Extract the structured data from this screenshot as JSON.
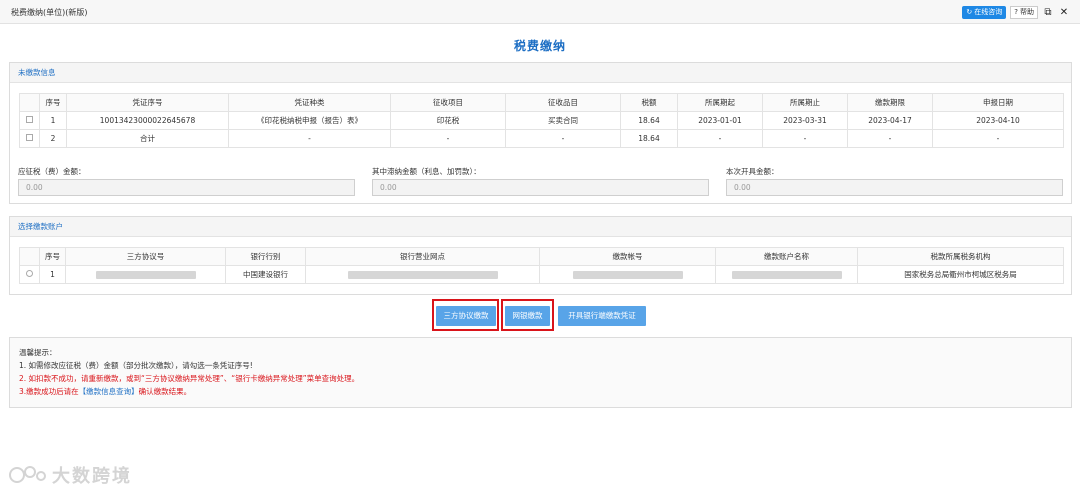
{
  "window": {
    "title": "税费缴纳(单位)(新版)",
    "online_consult": "在线咨询",
    "help": "帮助"
  },
  "page_title": "税费缴纳",
  "unpaid": {
    "section_title": "未缴款信息",
    "headers": [
      "序号",
      "凭证序号",
      "凭证种类",
      "征收项目",
      "征收品目",
      "税额",
      "所属期起",
      "所属期止",
      "缴款期限",
      "申报日期"
    ],
    "rows": [
      {
        "seq": "1",
        "voucher_no": "10013423000022645678",
        "voucher_type": "《印花税纳税申报（报告）表》",
        "item": "印花税",
        "sub_item": "买卖合同",
        "tax": "18.64",
        "period_start": "2023-01-01",
        "period_end": "2023-03-31",
        "deadline": "2023-04-17",
        "declare_date": "2023-04-10"
      },
      {
        "seq": "2",
        "voucher_no": "合计",
        "voucher_type": "-",
        "item": "-",
        "sub_item": "-",
        "tax": "18.64",
        "period_start": "-",
        "period_end": "-",
        "deadline": "-",
        "declare_date": "-"
      }
    ],
    "amounts": {
      "due_label": "应征税（费）金额：",
      "due_value": "0.00",
      "late_label": "其中滞纳金额（利息、加罚款）：",
      "late_value": "0.00",
      "invoice_label": "本次开具金额：",
      "invoice_value": "0.00"
    }
  },
  "account": {
    "section_title": "选择缴款账户",
    "headers": [
      "序号",
      "三方协议号",
      "银行行别",
      "银行营业网点",
      "缴款帐号",
      "缴款账户名称",
      "税款所属税务机构"
    ],
    "rows": [
      {
        "seq": "1",
        "agreement_no": "",
        "bank": "中国建设银行",
        "branch": "",
        "account_no": "",
        "account_name": "",
        "tax_office": "国家税务总局衢州市柯城区税务局"
      }
    ]
  },
  "actions": {
    "pay_tripartite": "三方协议缴款",
    "pay_online": "网银缴款",
    "issue_voucher": "开具银行端缴款凭证"
  },
  "notice": {
    "title": "温馨提示：",
    "line1": "1. 如需修改应征税（费）金额（部分批次缴款），请勾选一条凭证序号!",
    "line2": "2. 如扣款不成功，请重新缴款，或到“三方协议缴纳异常处理”、“银行卡缴纳异常处理”菜单查询处理。",
    "line3_pre": "3.缴款成功后请在",
    "line3_link": "【缴款信息查询】",
    "line3_post": "确认缴款结果。"
  },
  "watermark": "大数跨境",
  "colors": {
    "accent": "#1e6fc4",
    "button": "#58a4e8",
    "highlight": "#d9141a",
    "online": "#1e88e5"
  }
}
